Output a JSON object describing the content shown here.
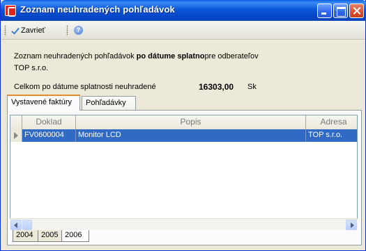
{
  "window": {
    "title": "Zoznam neuhradených pohľadávok"
  },
  "toolbar": {
    "close_label": "Zavrieť",
    "help_glyph": "?"
  },
  "info": {
    "line1_prefix": "Zoznam neuhradených  pohľadávok ",
    "line1_bold": "po dátume splatno",
    "line1_suffix": "pre odberateľov",
    "customer": "TOP s.r.o.",
    "total_label": "Celkom po dátume splatnosti neuhradené",
    "total_value": "16303,00",
    "total_unit": "Sk"
  },
  "tabs": [
    {
      "label": "Vystavené faktúry",
      "active": true
    },
    {
      "label": "Pohľadávky",
      "active": false
    }
  ],
  "grid": {
    "columns": [
      "Doklad",
      "Popis",
      "Adresa"
    ],
    "rows": [
      {
        "doklad": "FV0600004",
        "popis": "Monitor LCD",
        "adresa": "TOP s.r.o.",
        "selected": true
      }
    ]
  },
  "year_tabs": [
    {
      "label": "2004",
      "active": false
    },
    {
      "label": "2005",
      "active": false
    },
    {
      "label": "2006",
      "active": true
    }
  ],
  "colors": {
    "titlebar": "#0a57d8",
    "selection": "#316ac5",
    "active_tab_accent": "#e68b2c"
  },
  "icons": {
    "app": "app-logo-icon",
    "close_tool": "check-icon",
    "help": "help-icon"
  }
}
